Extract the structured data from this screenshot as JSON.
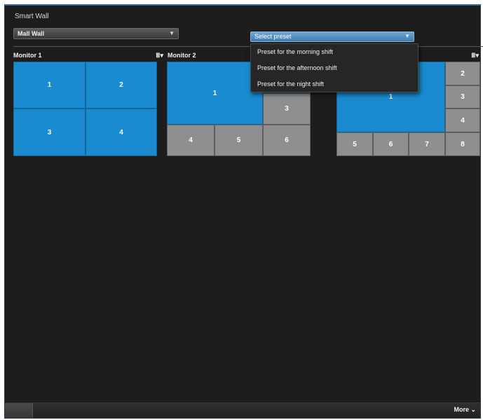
{
  "panel": {
    "title": "Smart Wall"
  },
  "wall_select": {
    "value": "Mall Wall",
    "arrow": "▼"
  },
  "preset_select": {
    "value": "Select preset",
    "arrow": "▼",
    "options": [
      "Preset for the morning shift",
      "Preset for the afternoon shift",
      "Preset for the night shift"
    ]
  },
  "monitors": [
    {
      "label": "Monitor 1",
      "layout_icon": "grid-layout-icon",
      "layout_glyph": "Ⅲ▾",
      "tiles": [
        "1",
        "2",
        "3",
        "4"
      ]
    },
    {
      "label": "Monitor 2",
      "layout_icon": "grid-layout-icon",
      "layout_glyph": "Ⅲ▾",
      "tiles": [
        "1",
        "3",
        "4",
        "5",
        "6"
      ]
    },
    {
      "label": "",
      "layout_icon": "grid-layout-icon",
      "layout_glyph": "Ⅲ▾",
      "tiles": [
        "1",
        "2",
        "3",
        "4",
        "5",
        "6",
        "7",
        "8"
      ]
    }
  ],
  "footer": {
    "more_label": "More ⌄"
  },
  "colors": {
    "tile_active": "#1a8bd0",
    "tile_inactive": "#8f8f8f",
    "background": "#1d1d1d"
  }
}
